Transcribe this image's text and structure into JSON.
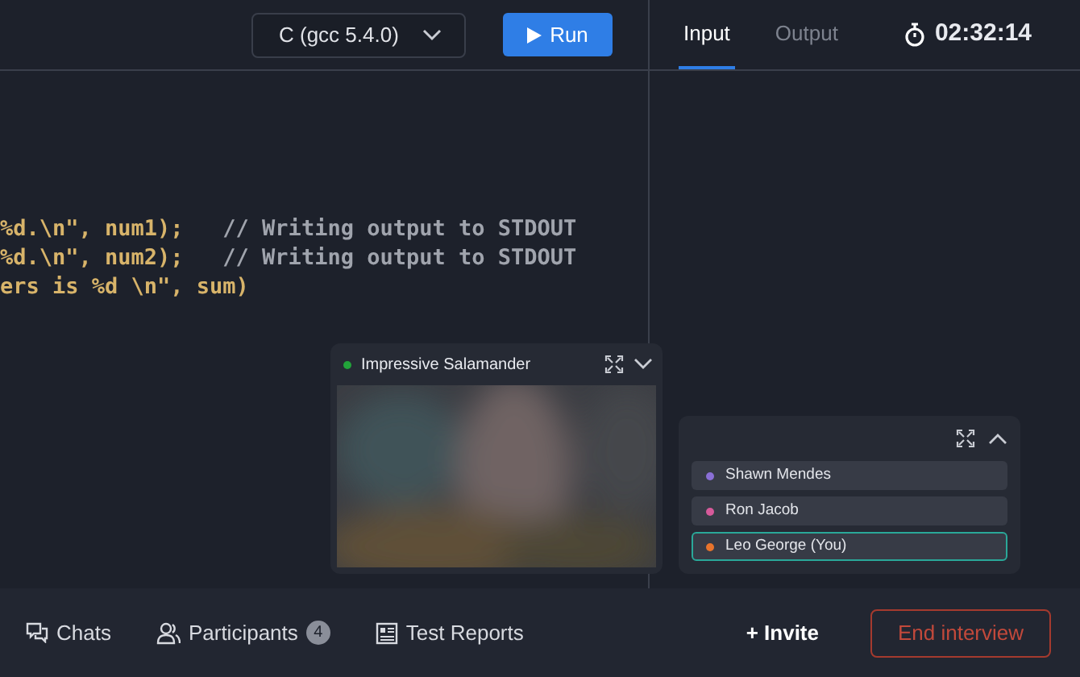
{
  "toolbar": {
    "language": "C (gcc 5.4.0)",
    "run_label": "Run"
  },
  "io_tabs": [
    {
      "label": "Input",
      "selected": true
    },
    {
      "label": "Output",
      "selected": false
    }
  ],
  "timer": "02:32:14",
  "code_lines": [
    {
      "code": "%d.\\n\", num1);   ",
      "comment": "// Writing output to STDOUT"
    },
    {
      "code": "%d.\\n\", num2);   ",
      "comment": "// Writing output to STDOUT"
    },
    {
      "code": "ers is %d \\n\", sum)"
    }
  ],
  "video_tile": {
    "name": "Impressive Salamander",
    "color": "#22a33a",
    "kind": "picture"
  },
  "participants": [
    {
      "name": "Shawn Mendes",
      "color": "#8a6fd6",
      "selected": false
    },
    {
      "name": "Ron Jacob",
      "color": "#d65a9a",
      "selected": false
    },
    {
      "name": "Leo George (You)",
      "color": "#e8742c",
      "selected": true
    }
  ],
  "bottom_bar": {
    "chats": "Chats",
    "participants": "Participants",
    "participants_count": "4",
    "test_reports": "Test Reports",
    "invite": "+ Invite",
    "end": "End interview"
  }
}
